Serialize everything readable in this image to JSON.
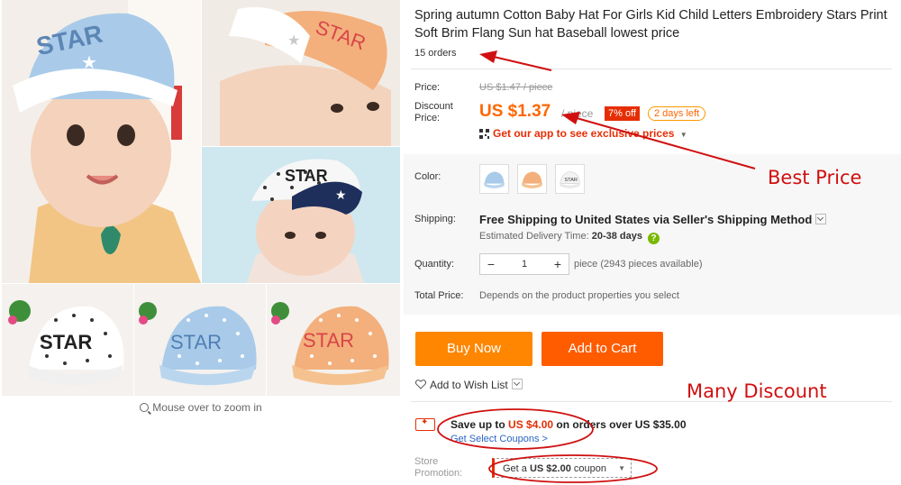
{
  "product": {
    "title": "Spring autumn Cotton Baby Hat For Girls Kid Child Letters Embroidery Stars Print Soft Brim Flang Sun hat Baseball lowest price",
    "orders": "15 orders"
  },
  "gallery": {
    "zoom_hint": "Mouse over to zoom in",
    "hat_text": "STAR"
  },
  "pricing": {
    "price_label": "Price:",
    "original_price": "US $1.47 / piece",
    "discount_label_line1": "Discount",
    "discount_label_line2": "Price:",
    "discount_price": "US $1.37",
    "per_unit": "/ piece",
    "off_badge": "7% off",
    "days_badge": "2 days left",
    "app_promo": "Get our app to see exclusive prices"
  },
  "options": {
    "color_label": "Color:",
    "colors": [
      "blue",
      "orange",
      "white"
    ],
    "shipping_label": "Shipping:",
    "shipping_method": "Free Shipping to United States via Seller's Shipping Method",
    "delivery_label": "Estimated Delivery Time:",
    "delivery_time": "20-38 days",
    "quantity_label": "Quantity:",
    "quantity_value": "1",
    "minus": "−",
    "plus": "+",
    "quantity_note": "piece (2943 pieces available)",
    "total_label": "Total Price:",
    "total_note": "Depends on the product properties you select"
  },
  "actions": {
    "buy_now": "Buy Now",
    "add_to_cart": "Add to Cart",
    "wish_list": "Add to Wish List"
  },
  "coupons": {
    "save_prefix": "Save up to",
    "save_amount": "US $4.00",
    "save_suffix": "on orders over US $35.00",
    "select_link": "Get Select Coupons >",
    "store_label_line1": "Store",
    "store_label_line2": "Promotion:",
    "store_coupon_prefix": "Get a",
    "store_coupon_amount": "US $2.00",
    "store_coupon_suffix": "coupon"
  },
  "annotations": {
    "best_price": "Best Price",
    "many_discount": "Many Discount"
  },
  "colors": {
    "accent_orange": "#ff6600",
    "badge_red": "#e62e04",
    "annotation_red": "#d01010",
    "link_blue": "#2b65c5"
  }
}
